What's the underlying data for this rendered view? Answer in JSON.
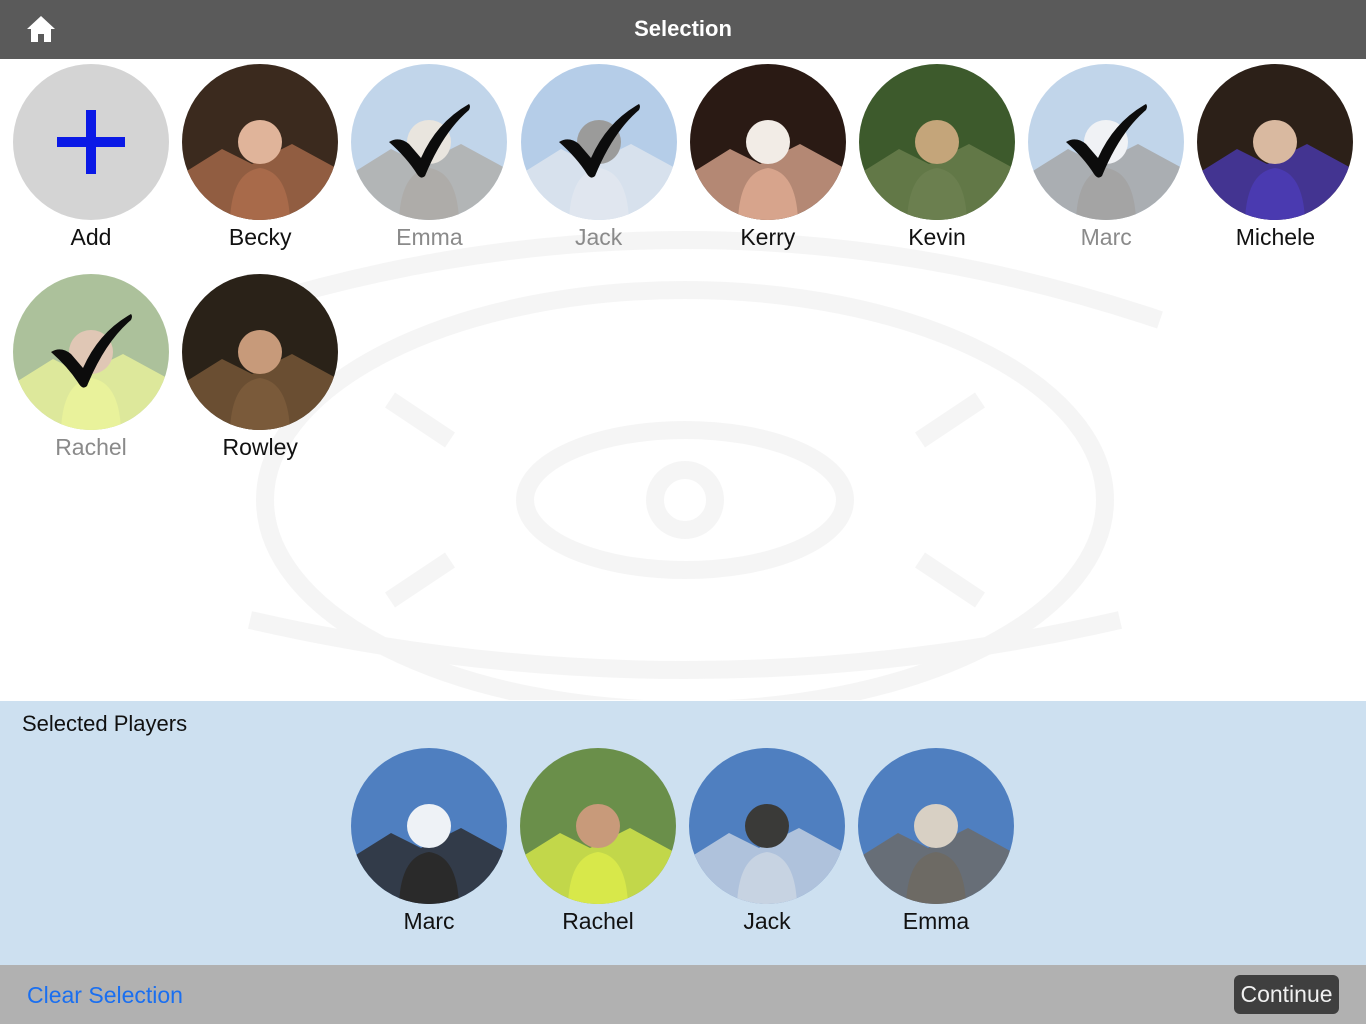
{
  "header": {
    "title": "Selection",
    "home_icon": "home-icon"
  },
  "players": [
    {
      "name": "Add",
      "type": "add",
      "selected": false
    },
    {
      "name": "Becky",
      "selected": false,
      "colors": [
        "#3b2a1e",
        "#a86a4a",
        "#e0b49a"
      ]
    },
    {
      "name": "Emma",
      "selected": true,
      "colors": [
        "#8fb3d9",
        "#6d6a64",
        "#d8d0c4"
      ]
    },
    {
      "name": "Jack",
      "selected": true,
      "colors": [
        "#7aa5d6",
        "#c7d3e2",
        "#4a4a48"
      ]
    },
    {
      "name": "Kerry",
      "selected": false,
      "colors": [
        "#2a1a14",
        "#d7a48c",
        "#f2ece6"
      ]
    },
    {
      "name": "Kevin",
      "selected": false,
      "colors": [
        "#3d5a2c",
        "#6b7f4f",
        "#c4a57a"
      ]
    },
    {
      "name": "Marc",
      "selected": true,
      "colors": [
        "#8fb3d9",
        "#5a5a5a",
        "#e4e8ee"
      ]
    },
    {
      "name": "Michele",
      "selected": false,
      "colors": [
        "#2c2018",
        "#4a3ab0",
        "#d9b9a0"
      ]
    },
    {
      "name": "Rachel",
      "selected": true,
      "colors": [
        "#6a8f4a",
        "#d8e84a",
        "#c89a7a"
      ]
    },
    {
      "name": "Rowley",
      "selected": false,
      "colors": [
        "#2a2218",
        "#7a5a3a",
        "#c79a7a"
      ]
    }
  ],
  "selected_panel": {
    "title": "Selected Players",
    "players": [
      {
        "name": "Marc",
        "colors": [
          "#4f7fc0",
          "#2a2a2a",
          "#eef2f6"
        ]
      },
      {
        "name": "Rachel",
        "colors": [
          "#6a8f4a",
          "#d8e84a",
          "#c89a7a"
        ]
      },
      {
        "name": "Jack",
        "colors": [
          "#4f7fc0",
          "#c7d3e2",
          "#3a3a38"
        ]
      },
      {
        "name": "Emma",
        "colors": [
          "#4f7fc0",
          "#6d6a64",
          "#d8d0c4"
        ]
      }
    ]
  },
  "footer": {
    "clear_label": "Clear Selection",
    "continue_label": "Continue"
  },
  "colors": {
    "add_plus": "#0a19e6",
    "clear_link": "#1a6ff0",
    "panel_bg": "#cde0f0"
  }
}
